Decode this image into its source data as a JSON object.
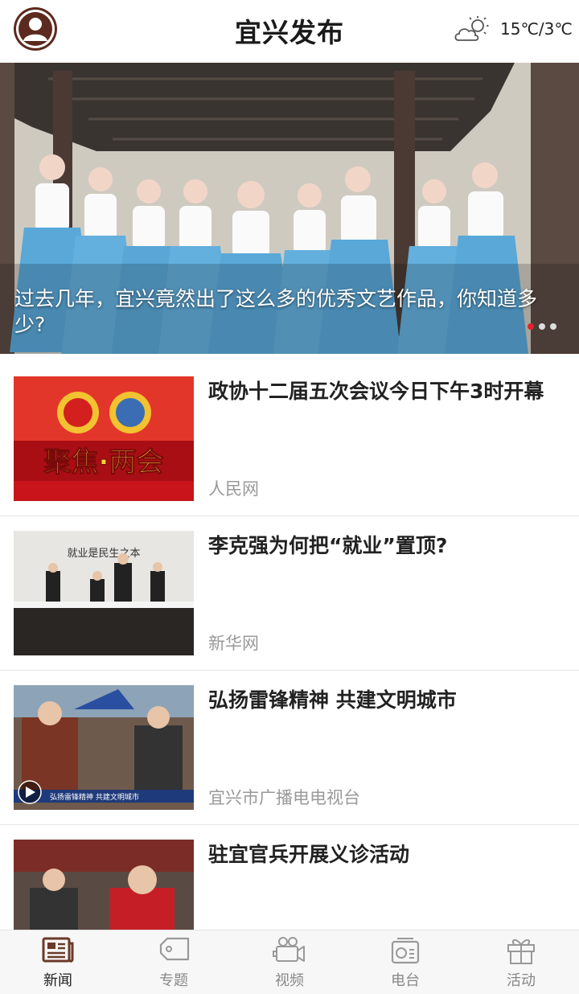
{
  "header": {
    "title": "宜兴发布",
    "weather": "15℃/3℃",
    "weather_icon": "partly-cloudy-icon"
  },
  "banner": {
    "caption": "过去几年，宜兴竟然出了这么多的优秀文艺作品，你知道多少?",
    "slide_count": 3,
    "active_slide": 1
  },
  "news": [
    {
      "title": "政协十二届五次会议今日下午3时开幕",
      "source": "人民网",
      "thumb_text": "聚焦·两会"
    },
    {
      "title": "李克强为何把“就业”置顶?",
      "source": "新华网",
      "thumb_text": "就业是民生之本"
    },
    {
      "title": "弘扬雷锋精神 共建文明城市",
      "source": "宜兴市广播电电视台",
      "thumb_text": "弘扬雷锋精神 共建文明城市"
    },
    {
      "title": "驻宜官兵开展义诊活动",
      "source": ""
    }
  ],
  "tabs": [
    {
      "label": "新闻",
      "icon": "newspaper-icon",
      "active": true
    },
    {
      "label": "专题",
      "icon": "tag-icon",
      "active": false
    },
    {
      "label": "视频",
      "icon": "video-camera-icon",
      "active": false
    },
    {
      "label": "电台",
      "icon": "radio-icon",
      "active": false
    },
    {
      "label": "活动",
      "icon": "gift-icon",
      "active": false
    }
  ],
  "colors": {
    "accent": "#e0242a",
    "avatar_bg": "#5c2a1e",
    "active_tab_icon": "#6b3a2a",
    "inactive_tab": "#999999"
  }
}
